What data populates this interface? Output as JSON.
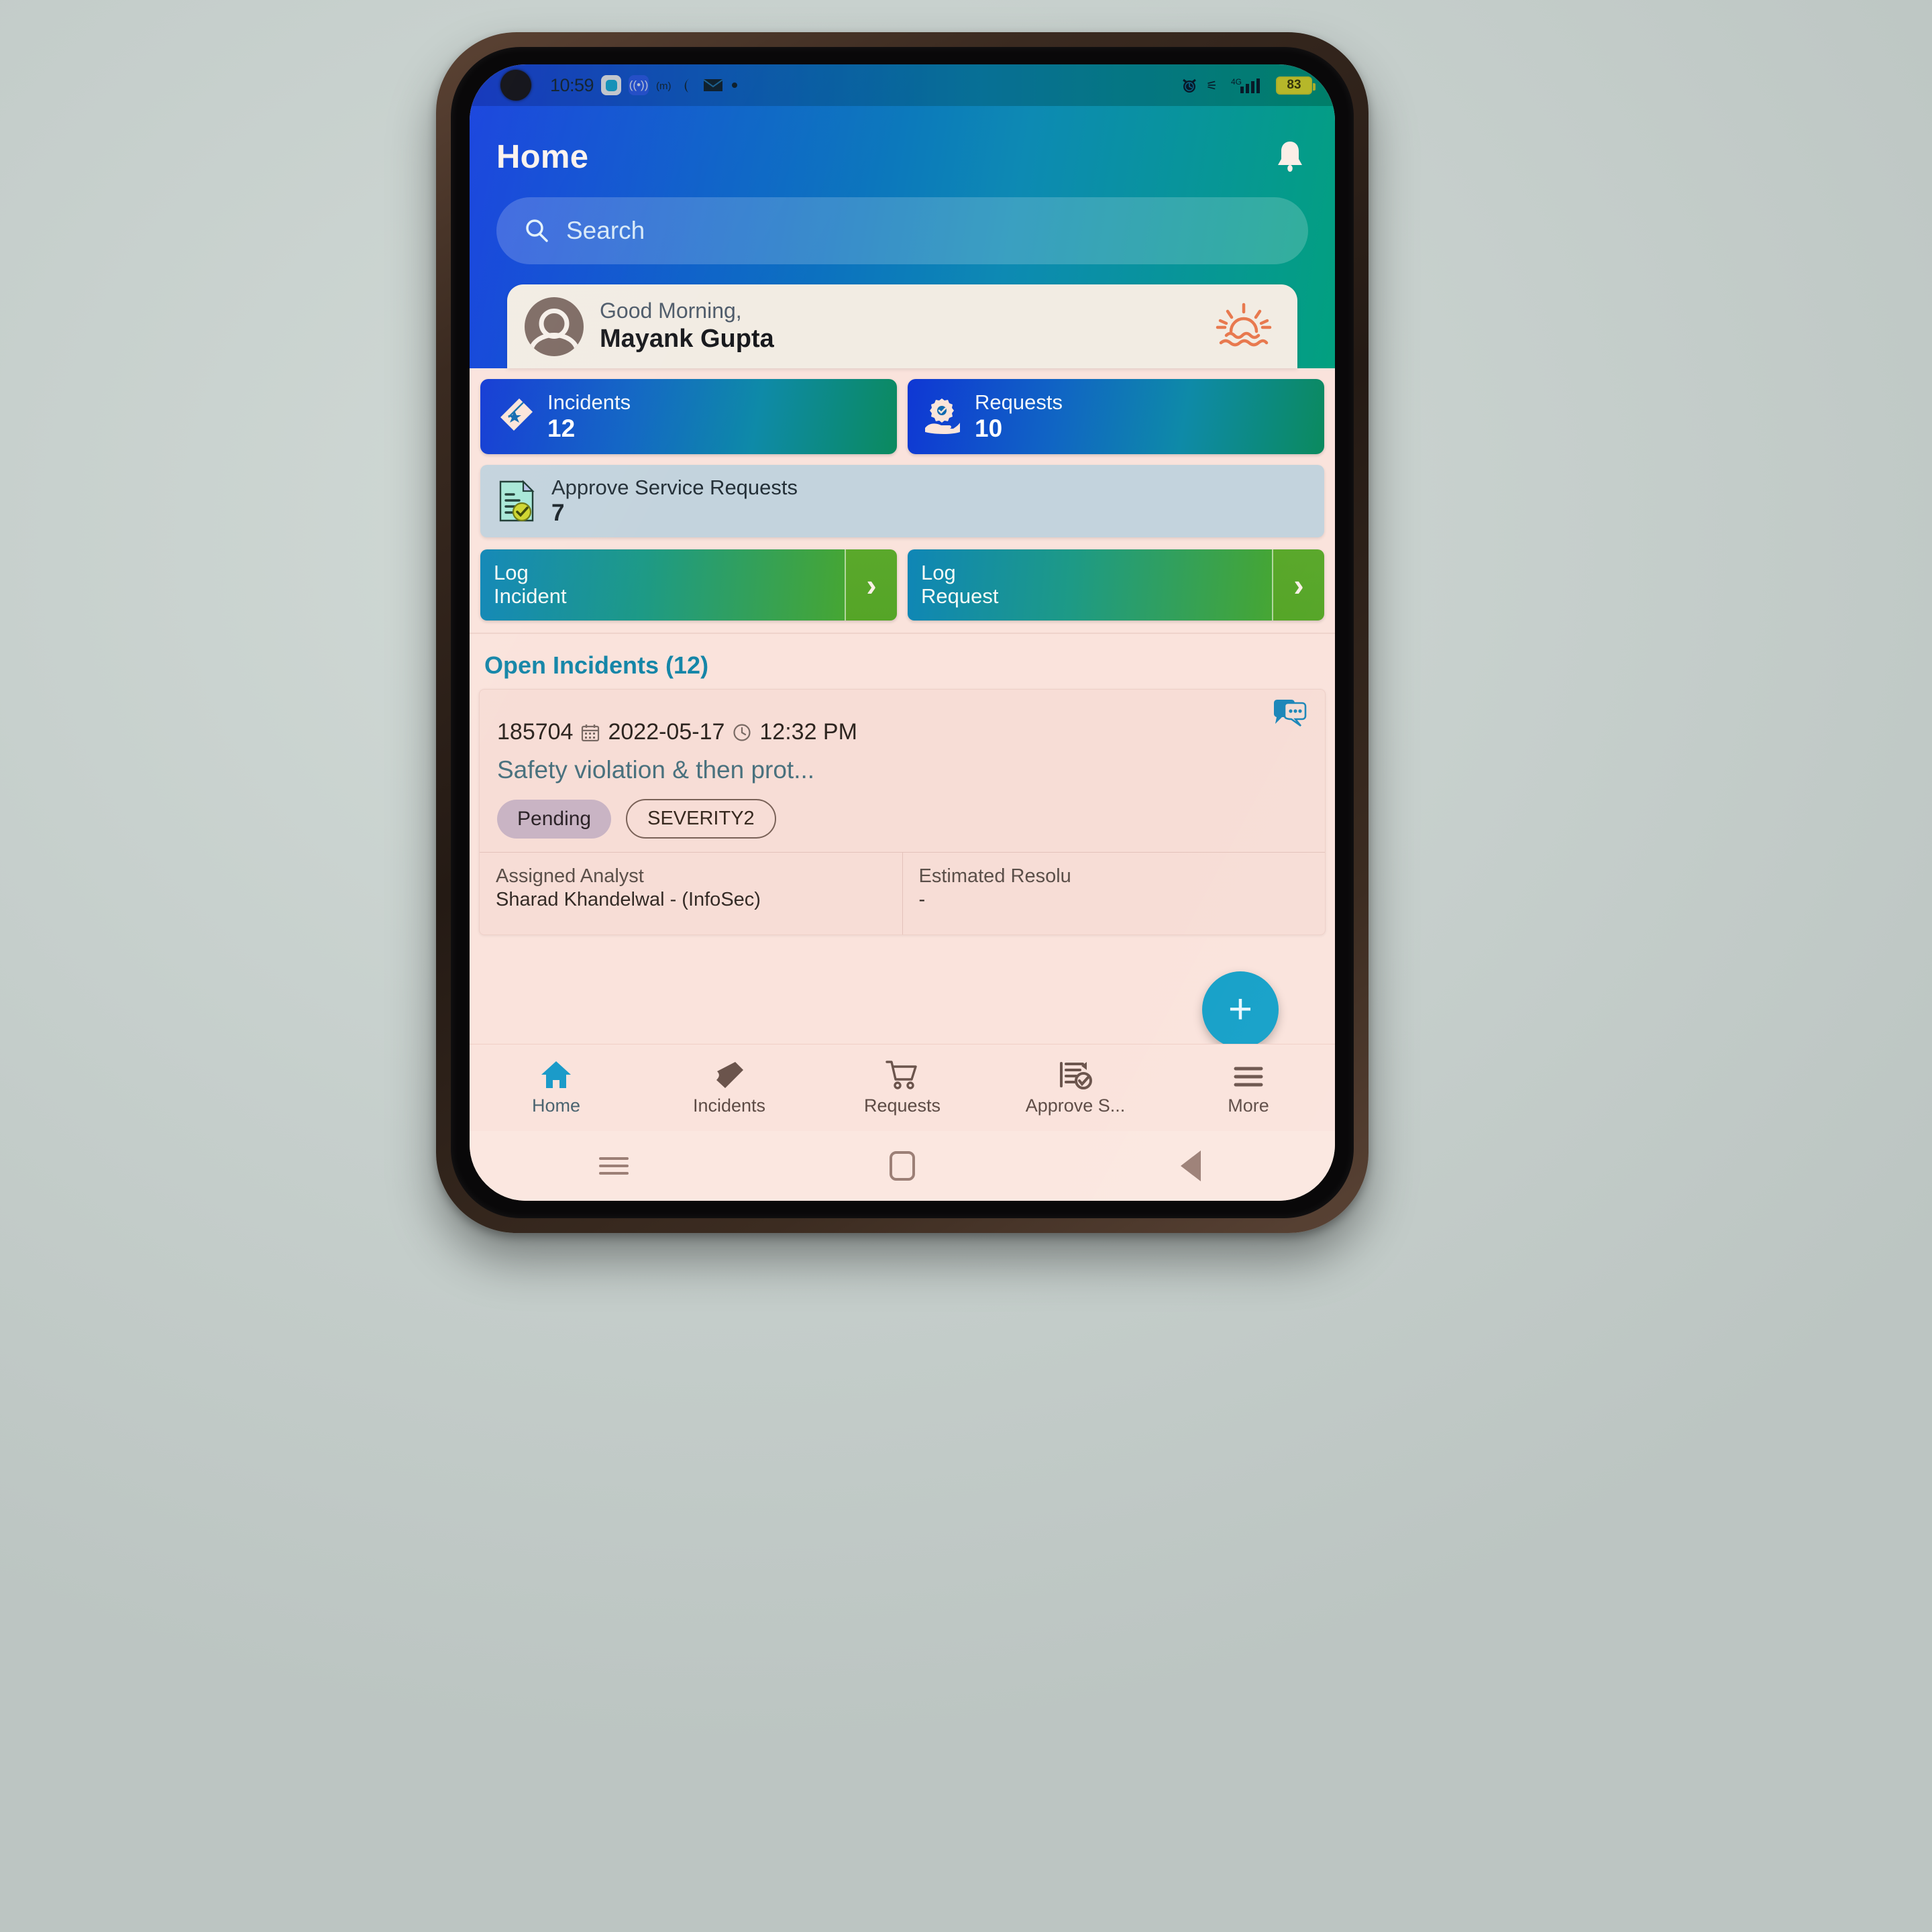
{
  "status_bar": {
    "time": "10:59",
    "battery_percent": "83",
    "network": "4G",
    "icons": [
      "camera-punch-hole",
      "app-badge-icon",
      "hotspot-icon",
      "vibrate-icon",
      "sim-icon",
      "mail-icon",
      "dot-icon",
      "alarm-icon",
      "vibrate-mode-icon",
      "signal-icon",
      "battery-icon"
    ]
  },
  "header": {
    "title": "Home",
    "bell_icon": "notification-bell-icon"
  },
  "search": {
    "placeholder": "Search",
    "icon": "search-icon"
  },
  "greeting": {
    "salutation": "Good Morning,",
    "user_name": "Mayank Gupta",
    "avatar_icon": "user-avatar-icon",
    "decor_icon": "sunrise-icon"
  },
  "quick_actions": {
    "stats": [
      {
        "label": "Incidents",
        "value": "12",
        "icon": "ticket-icon"
      },
      {
        "label": "Requests",
        "value": "10",
        "icon": "gear-in-hand-icon"
      }
    ],
    "approve": {
      "label": "Approve Service Requests",
      "value": "7",
      "icon": "document-check-icon"
    },
    "log_buttons": [
      {
        "line1": "Log",
        "line2": "Incident",
        "chevron": "chevron-right-icon"
      },
      {
        "line1": "Log",
        "line2": "Request",
        "chevron": "chevron-right-icon"
      }
    ]
  },
  "open_incidents": {
    "section_title": "Open Incidents (12)",
    "card": {
      "id": "185704",
      "date": "2022-05-17",
      "time": "12:32 PM",
      "date_icon": "calendar-icon",
      "time_icon": "clock-icon",
      "chat_icon": "chat-bubble-icon",
      "title": "Safety violation & then prot...",
      "status_chip": "Pending",
      "severity_chip": "SEVERITY2",
      "details": [
        {
          "label": "Assigned Analyst",
          "value": "Sharad Khandelwal - (InfoSec)"
        },
        {
          "label": "Estimated Resolu",
          "value": "-"
        }
      ]
    }
  },
  "fab": {
    "label": "+",
    "icon": "plus-icon",
    "color": "#14a0c8"
  },
  "bottom_nav": {
    "items": [
      {
        "label": "Home",
        "icon": "home-icon",
        "active": true
      },
      {
        "label": "Incidents",
        "icon": "ticket-icon",
        "active": false
      },
      {
        "label": "Requests",
        "icon": "shopping-cart-icon",
        "active": false
      },
      {
        "label": "Approve S...",
        "icon": "checklist-icon",
        "active": false
      },
      {
        "label": "More",
        "icon": "hamburger-menu-icon",
        "active": false
      }
    ]
  },
  "android_nav": {
    "recents_icon": "recents-icon",
    "home_icon": "home-square-icon",
    "back_icon": "back-triangle-icon"
  },
  "colors": {
    "header_start": "#0d3bdc",
    "header_end": "#02a07f",
    "body_background": "#fae3dc",
    "accent": "#14a0c8",
    "section_title": "#1586a8"
  }
}
